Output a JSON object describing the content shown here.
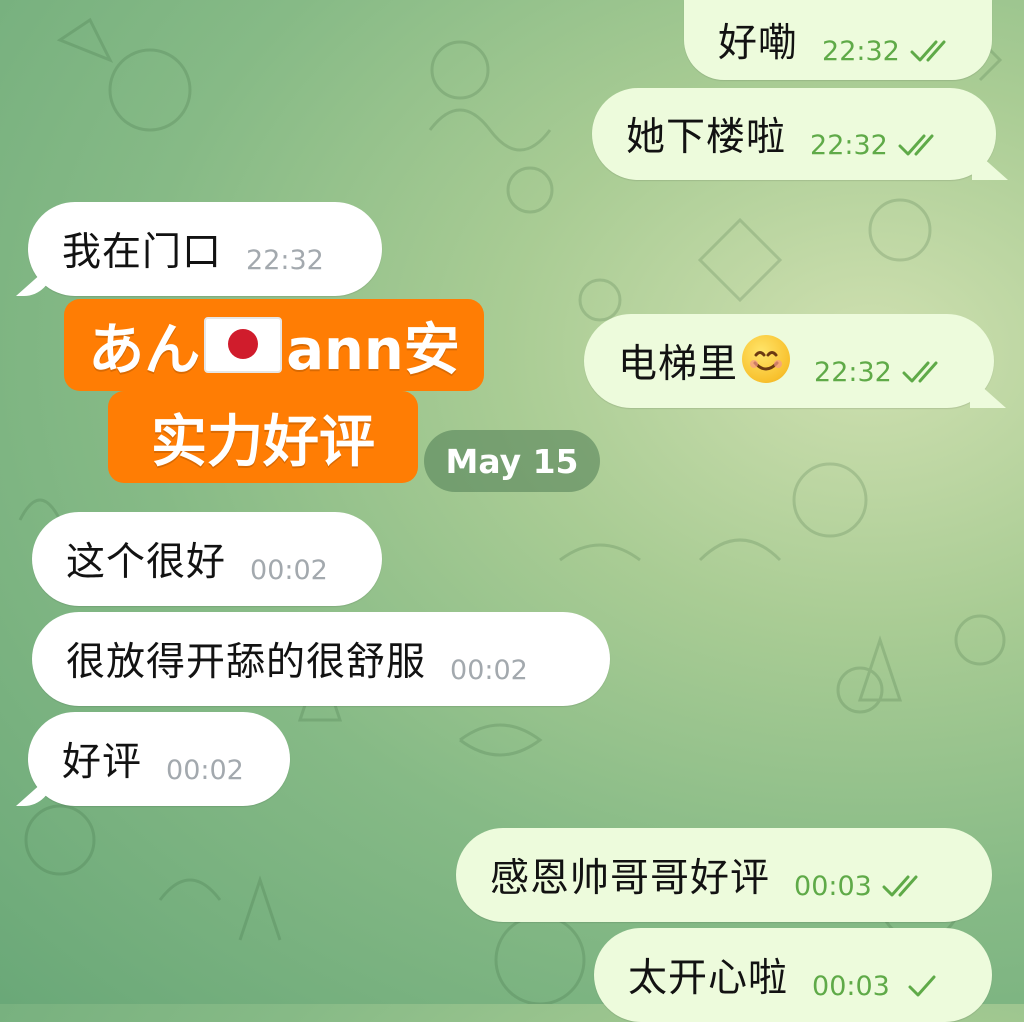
{
  "messages": [
    {
      "id": "m1",
      "direction": "out",
      "text": "好嘞",
      "time": "22:32",
      "status": "read"
    },
    {
      "id": "m2",
      "direction": "out",
      "text": "她下楼啦",
      "time": "22:32",
      "status": "read"
    },
    {
      "id": "m3",
      "direction": "in",
      "text": "我在门口",
      "time": "22:32"
    },
    {
      "id": "m4",
      "direction": "out",
      "text": "电梯里",
      "emoji": "smiling-face-emoji",
      "time": "22:32",
      "status": "read"
    },
    {
      "id": "m5",
      "direction": "in",
      "text": "这个很好",
      "time": "00:02"
    },
    {
      "id": "m6",
      "direction": "in",
      "text": "很放得开舔的很舒服",
      "time": "00:02"
    },
    {
      "id": "m7",
      "direction": "in",
      "text": "好评",
      "time": "00:02"
    },
    {
      "id": "m8",
      "direction": "out",
      "text": "感恩帅哥哥好评",
      "time": "00:03",
      "status": "read"
    },
    {
      "id": "m9",
      "direction": "out",
      "text": "太开心啦",
      "time": "00:03",
      "status": "sent"
    }
  ],
  "sticker": {
    "line1_left": "あん",
    "line1_right": "ann安",
    "line2": "实力好评",
    "flag_icon": "japan-flag-icon"
  },
  "date_separator": "May 15",
  "colors": {
    "incoming_bubble": "#ffffff",
    "outgoing_bubble": "#edfbdc",
    "outgoing_time": "#5faa48",
    "incoming_time": "#a3a9ae",
    "sticker_orange": "#ff7d04"
  }
}
